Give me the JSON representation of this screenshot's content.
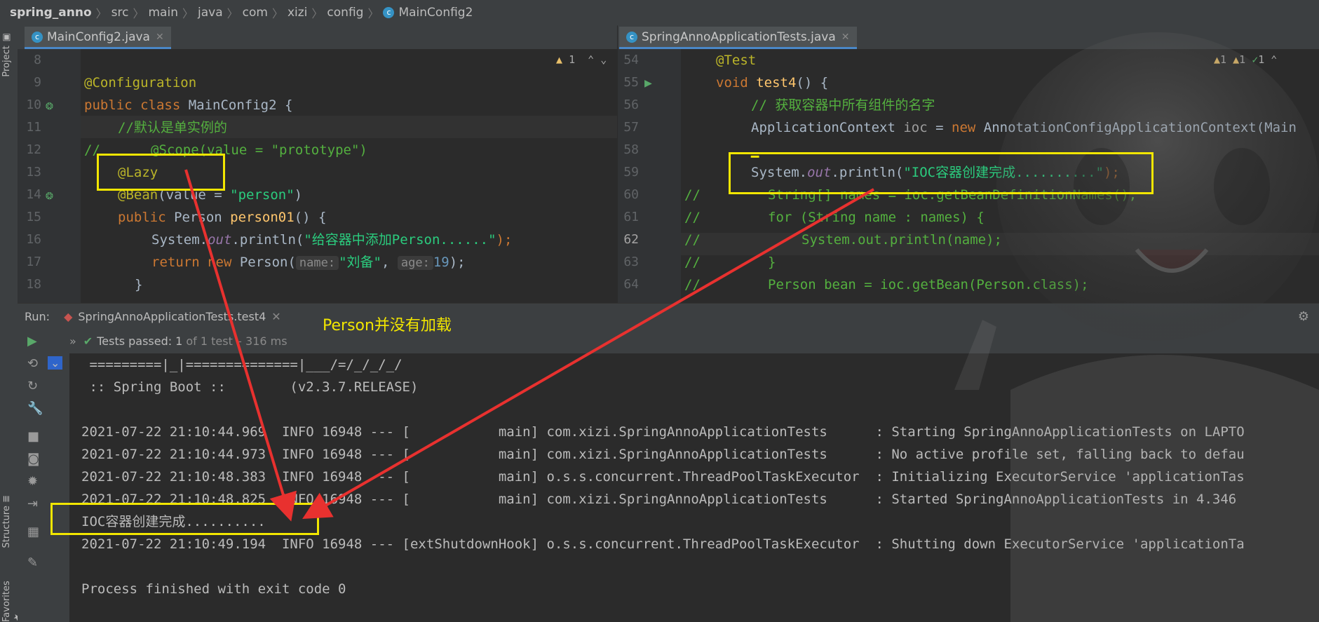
{
  "breadcrumb": [
    "spring_anno",
    "src",
    "main",
    "java",
    "com",
    "xizi",
    "config",
    "MainConfig2"
  ],
  "left_editor": {
    "tab": "MainConfig2.java",
    "inspections": "1",
    "lines": [
      {
        "n": "8"
      },
      {
        "n": "9"
      },
      {
        "n": "10"
      },
      {
        "n": "11"
      },
      {
        "n": "12"
      },
      {
        "n": "13"
      },
      {
        "n": "14"
      },
      {
        "n": "15"
      },
      {
        "n": "16"
      },
      {
        "n": "17"
      },
      {
        "n": "18"
      }
    ],
    "code": {
      "l9": "@Configuration",
      "l10a": "public class ",
      "l10b": "MainConfig2 {",
      "l11": "//默认是单实例的",
      "l12a": "//",
      "l12b": "@Scope(value = \"prototype\")",
      "l13": "@Lazy",
      "l14a": "@Bean",
      "l14b": "(value = ",
      "l14c": "\"person\"",
      "l14d": ")",
      "l15a": "public ",
      "l15b": "Person ",
      "l15c": "person01",
      "l15d": "() {",
      "l16a": "System.",
      "l16b": "out",
      "l16c": ".println(",
      "l16d": "\"给容器中添加Person......\"",
      "l16e": ");",
      "l17a": "return new ",
      "l17b": "Person(",
      "l17c": "name:",
      "l17d": "\"刘备\"",
      "l17e": ", ",
      "l17f": "age:",
      "l17g": "19",
      "l17h": ");",
      "l18": "}"
    }
  },
  "right_editor": {
    "tab": "SpringAnnoApplicationTests.java",
    "inspections": {
      "warn1": "1",
      "warn2": "1",
      "ok": "1"
    },
    "lines": [
      {
        "n": "54"
      },
      {
        "n": "55"
      },
      {
        "n": "56"
      },
      {
        "n": "57"
      },
      {
        "n": "58"
      },
      {
        "n": "59"
      },
      {
        "n": "60"
      },
      {
        "n": "61"
      },
      {
        "n": "62"
      },
      {
        "n": "63"
      },
      {
        "n": "64"
      }
    ],
    "code": {
      "l54": "@Test",
      "l55a": "void ",
      "l55b": "test4",
      "l55c": "() {",
      "l56": "// 获取容器中所有组件的名字",
      "l57a": "ApplicationContext ",
      "l57b": "ioc",
      "l57c": " = ",
      "l57d": "new ",
      "l57e": "AnnotationConfigApplicationContext(Main",
      "l59a": "System.",
      "l59b": "out",
      "l59c": ".println(",
      "l59d": "\"IOC容器创建完成..........\"",
      "l59e": ");",
      "l60a": "//",
      "l60b": "String[] names = ioc.getBeanDefinitionNames();",
      "l61a": "//",
      "l61b": "for (String name : names) {",
      "l62a": "//",
      "l62b": "System.out.println(name);",
      "l63a": "//",
      "l63b": "}",
      "l64a": "//",
      "l64b": "Person bean = ioc.getBean(Person.class);"
    }
  },
  "run_panel": {
    "label": "Run:",
    "config_tab": "SpringAnnoApplicationTests.test4",
    "status_prefix": "Tests passed:",
    "status_count": "1",
    "status_rest": "of 1 test – 316 ms"
  },
  "annotation": "Person并没有加载",
  "console": [
    " =========|_|==============|___/=/_/_/_/",
    " :: Spring Boot ::        (v2.3.7.RELEASE)",
    "",
    "2021-07-22 21:10:44.969  INFO 16948 --- [           main] com.xizi.SpringAnnoApplicationTests      : Starting SpringAnnoApplicationTests on LAPTO",
    "2021-07-22 21:10:44.973  INFO 16948 --- [           main] com.xizi.SpringAnnoApplicationTests      : No active profile set, falling back to defau",
    "2021-07-22 21:10:48.383  INFO 16948 --- [           main] o.s.s.concurrent.ThreadPoolTaskExecutor  : Initializing ExecutorService 'applicationTas",
    "2021-07-22 21:10:48.825  INFO 16948 --- [           main] com.xizi.SpringAnnoApplicationTests      : Started SpringAnnoApplicationTests in 4.346",
    "IOC容器创建完成..........",
    "2021-07-22 21:10:49.194  INFO 16948 --- [extShutdownHook] o.s.s.concurrent.ThreadPoolTaskExecutor  : Shutting down ExecutorService 'applicationTa",
    "",
    "Process finished with exit code 0"
  ],
  "side_tabs": {
    "project": "Project",
    "structure": "Structure",
    "favorites": "Favorites"
  },
  "colors": {
    "highlight": "#f2e600",
    "arrow": "#e8312f",
    "tests_passed": "#59a869"
  }
}
